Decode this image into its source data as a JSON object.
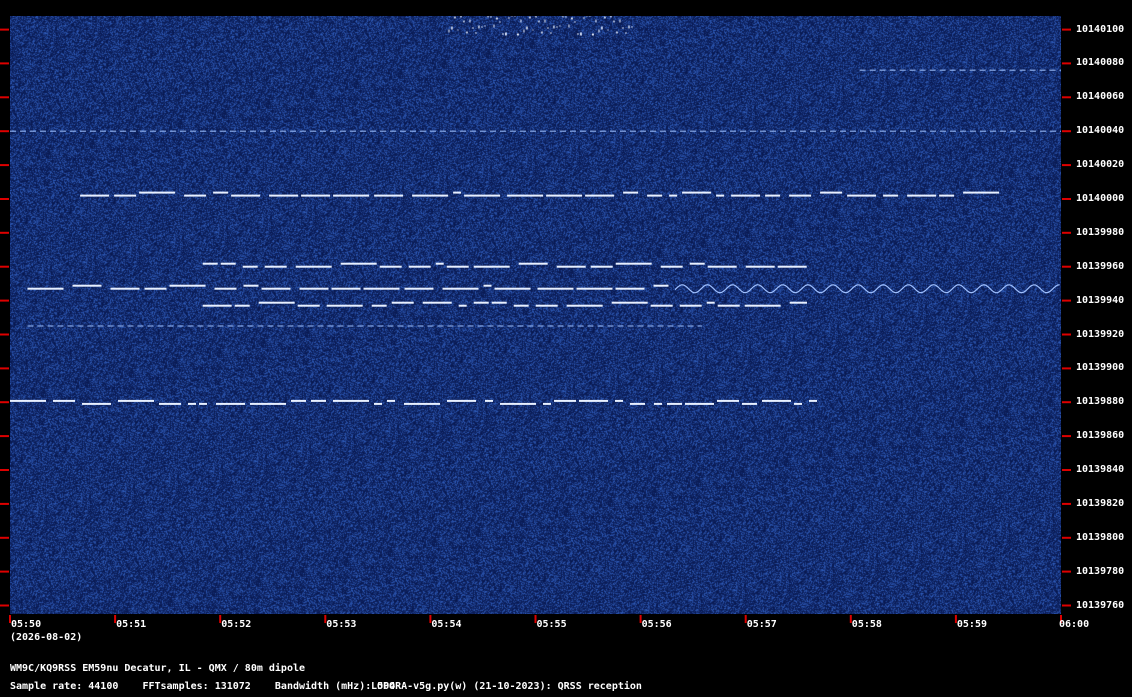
{
  "chart_data": {
    "type": "heatmap",
    "title": "",
    "xlabel": "",
    "ylabel": "",
    "date": "(2026-08-02)",
    "x_ticks": [
      "05:50",
      "05:51",
      "05:52",
      "05:53",
      "05:54",
      "05:55",
      "05:56",
      "05:57",
      "05:58",
      "05:59",
      "06:00"
    ],
    "y_ticks": [
      10140100,
      10140080,
      10140060,
      10140040,
      10140020,
      10140000,
      10139980,
      10139960,
      10139940,
      10139920,
      10139900,
      10139880,
      10139860,
      10139840,
      10139820,
      10139800,
      10139780,
      10139760
    ],
    "x_range": [
      "05:50",
      "06:00"
    ],
    "y_range": [
      10139755,
      10140108
    ],
    "colors": {
      "background": "#0c2064",
      "signal": "#e8f0ff",
      "tick": "#dd0000",
      "frame": "#000000"
    },
    "traces": [
      {
        "name": "",
        "freq": 10140002,
        "from": "05:50:40",
        "to": "05:59:25",
        "pattern": "qrss"
      },
      {
        "name": "",
        "freq": 10139960,
        "from": "05:51:50",
        "to": "05:57:35",
        "pattern": "qrss"
      },
      {
        "name": "",
        "freq": 10139947,
        "from": "05:50:10",
        "to": "05:56:20",
        "pattern": "qrss"
      },
      {
        "name": "",
        "freq": 10139947,
        "from": "05:56:20",
        "to": "06:00:00",
        "pattern": "wavy"
      },
      {
        "name": "",
        "freq": 10139937,
        "from": "05:51:50",
        "to": "05:57:35",
        "pattern": "qrss"
      },
      {
        "name": "",
        "freq": 10139925,
        "from": "05:50:10",
        "to": "05:56:35",
        "pattern": "faint"
      },
      {
        "name": "",
        "freq": 10139879,
        "from": "05:50:00",
        "to": "05:57:45",
        "pattern": "qrss"
      },
      {
        "name": "",
        "freq": 10140040,
        "from": "05:50:00",
        "to": "06:00:00",
        "pattern": "faint"
      },
      {
        "name": "",
        "freq": 10140076,
        "from": "05:58:05",
        "to": "06:00:00",
        "pattern": "faint"
      },
      {
        "name": "",
        "freq": 10140103,
        "from": "05:54:10",
        "to": "05:55:55",
        "pattern": "burst"
      }
    ]
  },
  "footer": {
    "station": "WM9C/KQ9RSS EM59nu Decatur, IL - QMX / 80m dipole",
    "params": "Sample rate: 44100    FFTsamples: 131072    Bandwidth (mHz): 504",
    "software": "LOPORA-v5g.py(w) (21-10-2023): QRSS reception"
  }
}
